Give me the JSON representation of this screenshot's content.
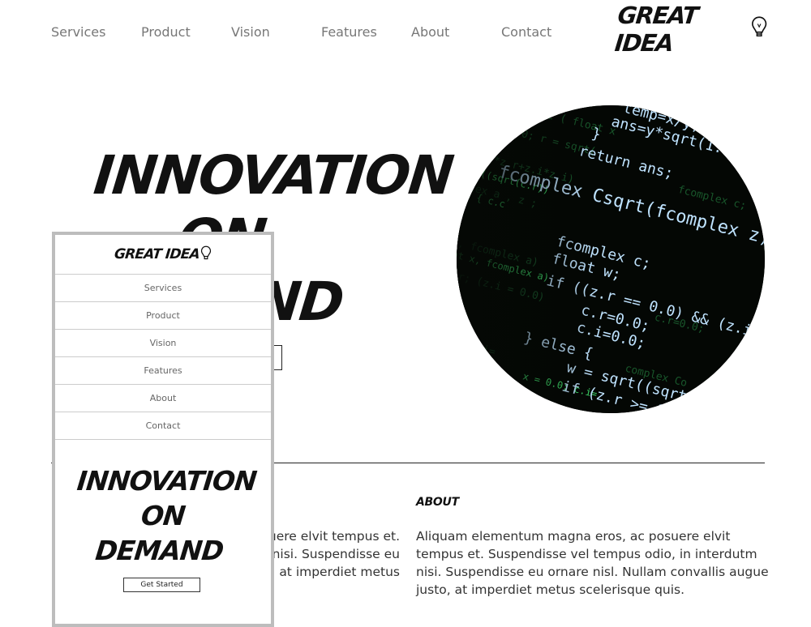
{
  "nav": {
    "items": [
      {
        "label": "Services"
      },
      {
        "label": "Product"
      },
      {
        "label": "Vision"
      },
      {
        "label": "Features"
      },
      {
        "label": "About"
      },
      {
        "label": "Contact"
      }
    ]
  },
  "brand": {
    "logo_text": "GREAT IDEA",
    "icon": "lightbulb-icon"
  },
  "hero": {
    "lines": [
      "INNOVATION",
      "ON",
      "DEMAND"
    ],
    "image": "code-screen-image"
  },
  "about": {
    "heading": "ABOUT",
    "body": "Aliquam elementum magna eros, ac posuere elvit tempus et. Suspendisse vel tempus odio, in interdutm nisi. Suspendisse eu ornare nisl. Nullam convallis augue justo, at imperdiet metus scelerisque quis.",
    "left_lines": [
      "uere elvit tempus et.",
      "m nisi. Suspendisse eu",
      "at imperdiet metus"
    ]
  },
  "mobile": {
    "logo_text": "GREAT IDEA",
    "menu": [
      "Services",
      "Product",
      "Vision",
      "Features",
      "About",
      "Contact"
    ],
    "hero_lines": [
      "INNOVATION",
      "ON",
      "DEMAND"
    ],
    "cta": "Get Started"
  },
  "colors": {
    "text": "#111111",
    "nav": "#777777",
    "code_green": "#3fdc6a",
    "code_blue": "#bfe3ff"
  }
}
